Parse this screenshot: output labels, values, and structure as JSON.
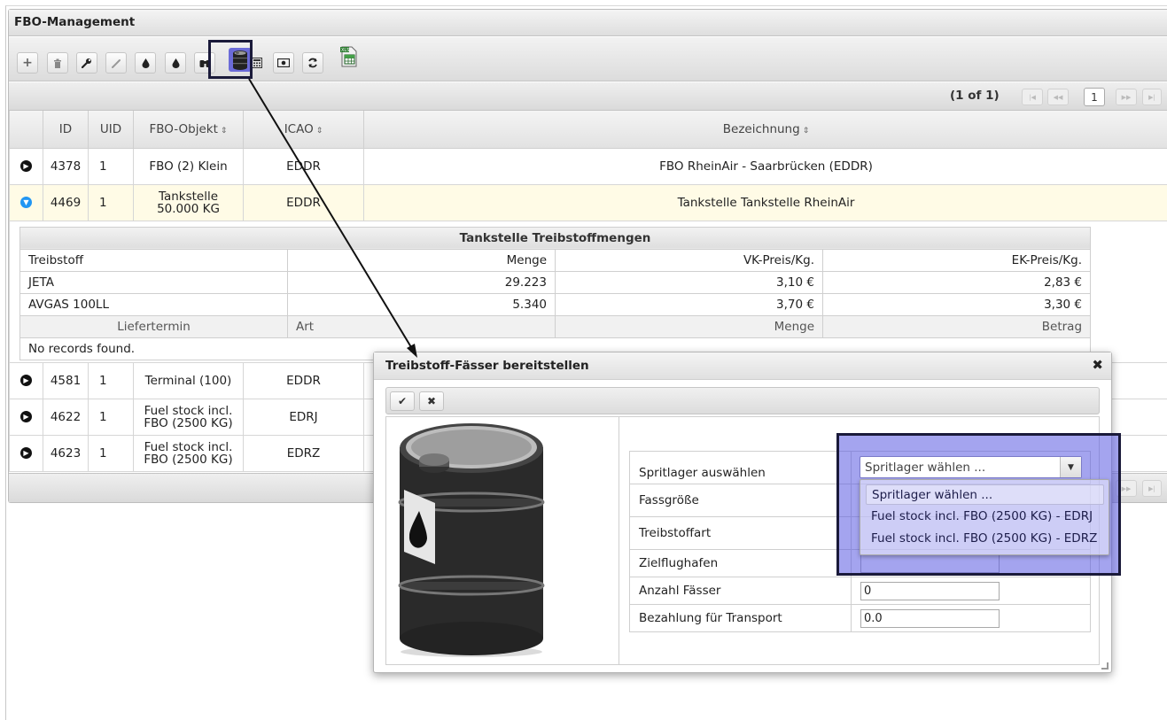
{
  "panel": {
    "title": "FBO-Management"
  },
  "toolbar": {
    "buttons": [
      {
        "name": "add-button",
        "glyph": "+"
      },
      {
        "name": "delete-button",
        "glyph": "trash"
      },
      {
        "name": "wrench-button",
        "glyph": "wrench"
      },
      {
        "name": "edit-button",
        "glyph": "pencil"
      },
      {
        "name": "fuel-drop-button",
        "glyph": "drop"
      },
      {
        "name": "fuel-drop-alt-button",
        "glyph": "drop"
      },
      {
        "name": "binoculars-button",
        "glyph": "binoculars"
      },
      {
        "name": "fuel-barrel-button",
        "glyph": "barrel"
      },
      {
        "name": "calculator-button",
        "glyph": "calculator"
      },
      {
        "name": "money-button",
        "glyph": "money"
      },
      {
        "name": "refresh-button",
        "glyph": "refresh"
      },
      {
        "name": "export-excel-button",
        "glyph": "excel"
      }
    ]
  },
  "pager": {
    "count": "(1 of 1)",
    "page": "1"
  },
  "grid": {
    "headers": {
      "id": "ID",
      "uid": "UID",
      "object": "FBO-Objekt",
      "icao": "ICAO",
      "name": "Bezeichnung"
    },
    "rows": [
      {
        "id": "4378",
        "uid": "1",
        "object": "FBO (2) Klein",
        "icao": "EDDR",
        "name": "FBO RheinAir - Saarbrücken (EDDR)"
      },
      {
        "id": "4469",
        "uid": "1",
        "object": "Tankstelle 50.000 KG",
        "icao": "EDDR",
        "name": "Tankstelle Tankstelle RheinAir"
      },
      {
        "id": "4581",
        "uid": "1",
        "object": "Terminal (100)",
        "icao": "EDDR",
        "name": ""
      },
      {
        "id": "4622",
        "uid": "1",
        "object": "Fuel stock incl. FBO (2500 KG)",
        "icao": "EDRJ",
        "name": ""
      },
      {
        "id": "4623",
        "uid": "1",
        "object": "Fuel stock incl. FBO (2500 KG)",
        "icao": "EDRZ",
        "name": ""
      }
    ]
  },
  "fuel_table": {
    "caption": "Tankstelle Treibstoffmengen",
    "headers": {
      "fuel": "Treibstoff",
      "amount": "Menge",
      "sell": "VK-Preis/Kg.",
      "buy": "EK-Preis/Kg."
    },
    "rows": [
      {
        "fuel": "JETA",
        "amount": "29.223",
        "sell": "3,10 €",
        "buy": "2,83 €"
      },
      {
        "fuel": "AVGAS 100LL",
        "amount": "5.340",
        "sell": "3,70 €",
        "buy": "3,30 €"
      }
    ],
    "delivery_headers": {
      "date": "Liefertermin",
      "kind": "Art",
      "amount": "Menge",
      "sum": "Betrag"
    },
    "empty": "No records found."
  },
  "dialog": {
    "title": "Treibstoff-Fässer bereitstellen",
    "fields": {
      "storage_label": "Spritlager auswählen",
      "barrel_size_label": "Fassgröße",
      "fuel_type_label": "Treibstoffart",
      "destination_label": "Zielflughafen",
      "barrel_count_label": "Anzahl Fässer",
      "transport_label": "Bezahlung für Transport",
      "barrel_count_value": "0",
      "transport_value": "0.0"
    },
    "dropdown": {
      "selected": "Spritlager wählen ...",
      "options": [
        "Spritlager wählen ...",
        "Fuel stock incl. FBO (2500 KG) - EDRJ",
        "Fuel stock incl. FBO (2500 KG) - EDRZ"
      ]
    }
  },
  "colors": {
    "highlight": "#6b6bd8",
    "expand_toggle": "#2196f3",
    "selected_row": "#fffbe6"
  }
}
